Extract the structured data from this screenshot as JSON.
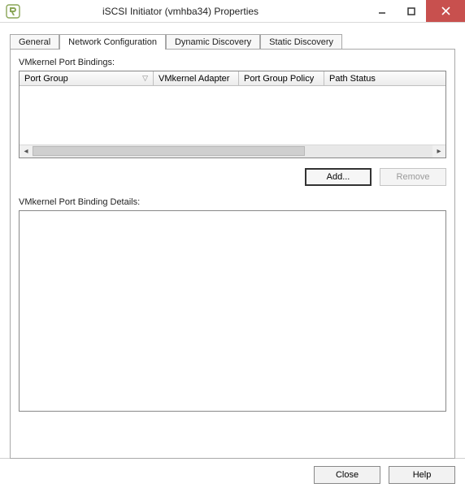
{
  "window": {
    "title": "iSCSI Initiator (vmhba34) Properties"
  },
  "tabs": {
    "general": "General",
    "network": "Network Configuration",
    "dynamic": "Dynamic Discovery",
    "static": "Static Discovery",
    "active": "network"
  },
  "panel": {
    "bindings_label": "VMkernel Port Bindings:",
    "details_label": "VMkernel Port Binding Details:",
    "columns": {
      "port_group": "Port Group",
      "vmk_adapter": "VMkernel Adapter",
      "pg_policy": "Port Group Policy",
      "path_status": "Path Status"
    },
    "rows": []
  },
  "buttons": {
    "add": "Add...",
    "remove": "Remove",
    "close": "Close",
    "help": "Help"
  }
}
